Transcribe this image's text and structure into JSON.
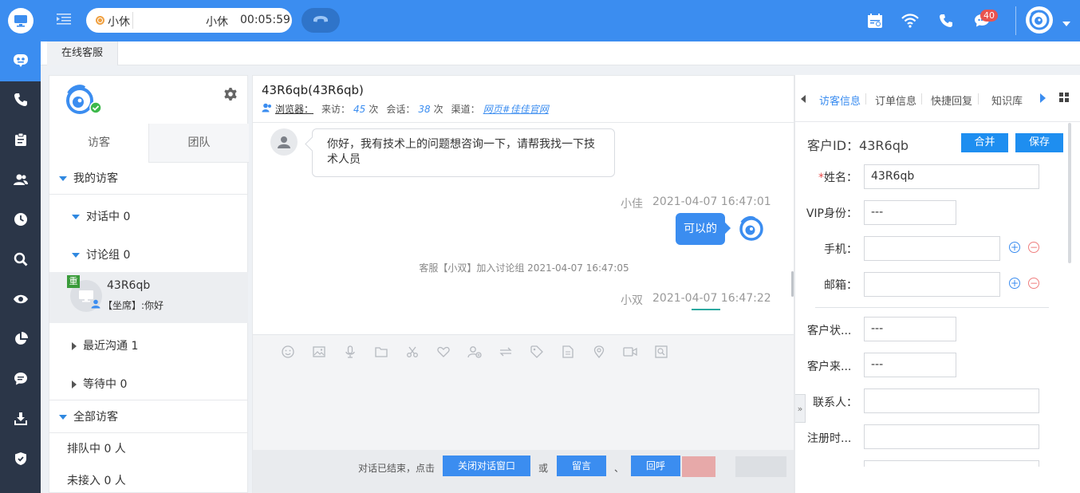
{
  "topbar": {
    "status_left": "小休",
    "status_right": "小休",
    "timer": "00:05:59",
    "notification_count": "40"
  },
  "tabs": {
    "online_service": "在线客服"
  },
  "visitor_panel": {
    "tab_visitors": "访客",
    "tab_team": "团队",
    "my_visitors": "我的访客",
    "in_conversation": "对话中 0",
    "discussion_group": "讨论组 0",
    "visitor": {
      "tag": "重",
      "name": "43R6qb",
      "last_message": "【坐席】:你好"
    },
    "recent": "最近沟通 1",
    "waiting": "等待中 0",
    "all_visitors": "全部访客",
    "queued": "排队中 0 人",
    "not_connected": "未接入 0 人"
  },
  "chat": {
    "title": "43R6qb(43R6qb)",
    "meta": {
      "browser_label": "浏览器：",
      "visits_label": "来访：",
      "visits": "45",
      "visits_unit": "次",
      "sessions_label": "会话：",
      "sessions": "38",
      "sessions_unit": "次",
      "channel_label": "渠道：",
      "channel": "网页#佳佳官网"
    },
    "messages": {
      "incoming_text": "你好，我有技术上的问题想咨询一下，请帮我找一下技术人员",
      "agent1_name": "小佳",
      "agent1_time": "2021-04-07 16:47:01",
      "outgoing_text": "可以的",
      "system_text": "客服【小双】加入讨论组  2021-04-07 16:47:05",
      "agent2_name": "小双",
      "agent2_time": "2021-04-07 16:47:22"
    },
    "footer": {
      "ended_text": "对话已结束，点击",
      "close_button": "关闭对话窗口",
      "or_text": "或",
      "leave_message_button": "留言",
      "comma_text": "、",
      "callback_button": "回呼"
    }
  },
  "info_panel": {
    "tabs": [
      "访客信息",
      "订单信息",
      "快捷回复",
      "知识库"
    ],
    "customer_id_label": "客户ID：",
    "customer_id": "43R6qb",
    "merge_button": "合并",
    "save_button": "保存",
    "fields": {
      "name_label": "姓名：",
      "name_value": "43R6qb",
      "vip_label": "VIP身份：",
      "vip_value": "---",
      "phone_label": "手机：",
      "email_label": "邮箱：",
      "customer_status_label": "客户状...",
      "customer_status_value": "---",
      "customer_source_label": "客户来...",
      "customer_source_value": "---",
      "contact_label": "联系人：",
      "register_time_label": "注册时..."
    }
  },
  "colors": {
    "primary": "#3b8df0",
    "rail": "#2b3648",
    "accent_red": "#e8534f"
  }
}
